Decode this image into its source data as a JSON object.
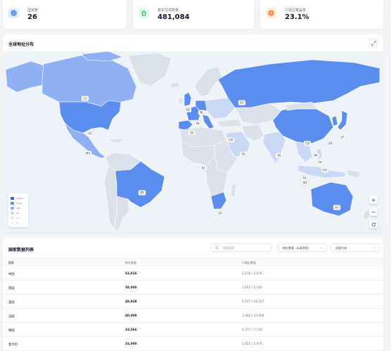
{
  "stats": [
    {
      "label": "国家数",
      "value": "26",
      "icon": "globe-icon",
      "color": "#2563eb",
      "bg": "#e0ecff"
    },
    {
      "label": "真实住宅数量",
      "value": "481,084",
      "icon": "home-icon",
      "color": "#16a34a",
      "bg": "#dcfce7"
    },
    {
      "label": "行政区覆盖率",
      "value": "23.1%",
      "icon": "target-icon",
      "color": "#ea580c",
      "bg": "#ffedd5"
    }
  ],
  "map": {
    "title": "全球地址分布",
    "markers": [
      "CA",
      "US",
      "MX",
      "BR",
      "GB",
      "NL",
      "FR",
      "ES",
      "RU",
      "CN",
      "SA",
      "IN",
      "CN",
      "KR",
      "JP",
      "HK",
      "TH",
      "PH",
      "SG",
      "MY",
      "ID",
      "AU",
      "ZA",
      "TN",
      "NG"
    ],
    "legend": [
      "500K+",
      "300K",
      "10K",
      "1K",
      "1+",
      "0"
    ],
    "colors": {
      "ocean": "#eef2f9",
      "land": "#dbe1ea",
      "high": "#5b8def",
      "mid": "#8fb1f3",
      "low": "#c9d8f5",
      "border": "#ffffff"
    }
  },
  "table": {
    "title": "国家数据列表",
    "search_placeholder": "搜索国家",
    "sort_label": "地址数量（从高到低）",
    "filter_label": "全部大洲",
    "columns": [
      "国家",
      "地址数量",
      "行政区覆盖"
    ],
    "rows": [
      {
        "country": "中国",
        "count": "63,016",
        "coverage": "2,210 / 3,676"
      },
      {
        "country": "英国",
        "count": "50,000",
        "coverage": "1,607 / 4,100"
      },
      {
        "country": "美国",
        "count": "49,938",
        "coverage": "5,557 / 16,527"
      },
      {
        "country": "法国",
        "count": "40,000",
        "coverage": "2,462 / 10,858"
      },
      {
        "country": "德国",
        "count": "33,566",
        "coverage": "4,371 / 7,120"
      },
      {
        "country": "意大利",
        "count": "33,000",
        "coverage": "1,922 / 5,970"
      }
    ]
  }
}
